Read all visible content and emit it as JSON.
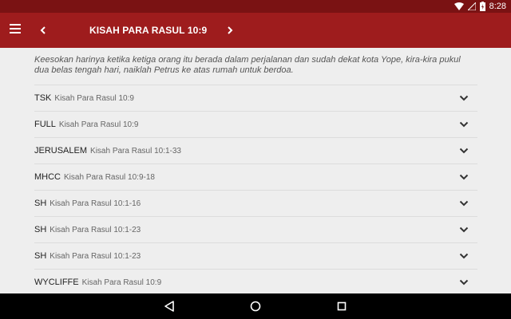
{
  "status_bar": {
    "time": "8:28"
  },
  "app_bar": {
    "title": "KISAH PARA RASUL 10:9"
  },
  "verse_text": "Keesokan harinya ketika ketiga orang itu berada dalam perjalanan dan sudah dekat kota Yope, kira-kira pukul dua belas tengah hari, naiklah Petrus ke atas rumah untuk berdoa.",
  "references": [
    {
      "code": "TSK",
      "ref": "Kisah Para Rasul 10:9"
    },
    {
      "code": "FULL",
      "ref": "Kisah Para Rasul 10:9"
    },
    {
      "code": "JERUSALEM",
      "ref": "Kisah Para Rasul 10:1-33"
    },
    {
      "code": "MHCC",
      "ref": "Kisah Para Rasul 10:9-18"
    },
    {
      "code": "SH",
      "ref": "Kisah Para Rasul 10:1-16"
    },
    {
      "code": "SH",
      "ref": "Kisah Para Rasul 10:1-23"
    },
    {
      "code": "SH",
      "ref": "Kisah Para Rasul 10:1-23"
    },
    {
      "code": "WYCLIFFE",
      "ref": "Kisah Para Rasul 10:9"
    }
  ],
  "colors": {
    "status_bar": "#7a1213",
    "app_bar": "#9e1c1d",
    "background": "#eeeeee",
    "nav_bar": "#000000"
  },
  "icons": {
    "menu": "hamburger-menu-icon",
    "prev": "chevron-left-icon",
    "next": "chevron-right-icon",
    "expand": "chevron-down-icon",
    "wifi": "wifi-icon",
    "signal": "signal-icon",
    "battery": "battery-charging-icon",
    "back": "back-triangle-icon",
    "home": "home-circle-icon",
    "recents": "recents-square-icon"
  }
}
